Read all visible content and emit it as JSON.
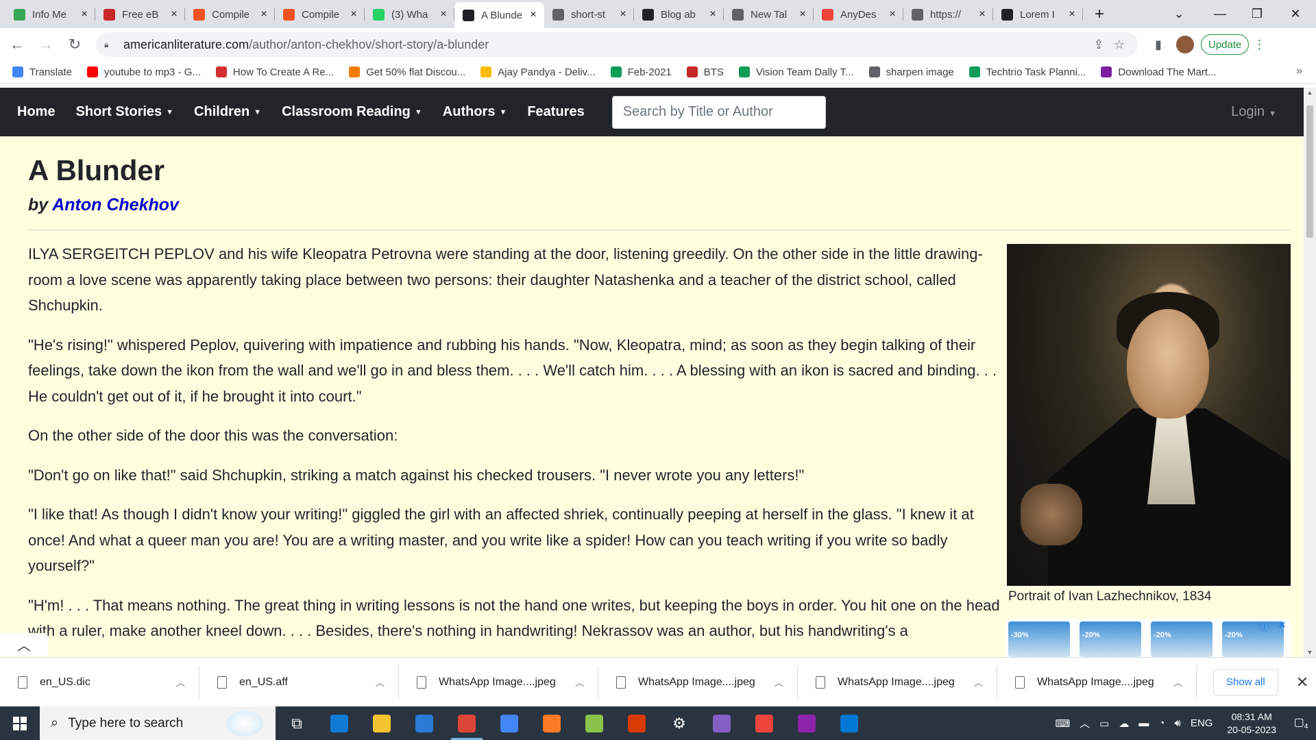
{
  "browser": {
    "tabs": [
      {
        "title": "Info Me",
        "icon": "info-favicon",
        "color": "#34a853"
      },
      {
        "title": "Free eB",
        "icon": "pg-favicon",
        "color": "#c62828"
      },
      {
        "title": "Compile",
        "icon": "microsoft-favicon",
        "color": "#f25022"
      },
      {
        "title": "Compile",
        "icon": "microsoft-favicon",
        "color": "#f25022"
      },
      {
        "title": "(3) Wha",
        "icon": "whatsapp-favicon",
        "color": "#25d366"
      },
      {
        "title": "A Blunde",
        "icon": "al-favicon",
        "color": "#202124"
      },
      {
        "title": "short-st",
        "icon": "globe-favicon",
        "color": "#5f6368"
      },
      {
        "title": "Blog ab",
        "icon": "blog-favicon",
        "color": "#202124"
      },
      {
        "title": "New Tal",
        "icon": "chrome-favicon",
        "color": "#5f6368"
      },
      {
        "title": "AnyDes",
        "icon": "anydesk-favicon",
        "color": "#ef443b"
      },
      {
        "title": "https://",
        "icon": "globe-favicon",
        "color": "#5f6368"
      },
      {
        "title": "Lorem I",
        "icon": "lorem-favicon",
        "color": "#202124"
      }
    ],
    "active_tab_index": 5,
    "url_domain": "americanliterature.com",
    "url_path": "/author/anton-chekhov/short-story/a-blunder",
    "update_label": "Update",
    "bookmarks": [
      {
        "label": "Translate",
        "color": "#4285f4"
      },
      {
        "label": "youtube to mp3 - G...",
        "color": "#ff0000"
      },
      {
        "label": "How To Create A Re...",
        "color": "#d32f2f"
      },
      {
        "label": "Get 50% flat Discou...",
        "color": "#f57c00"
      },
      {
        "label": "Ajay Pandya - Deliv...",
        "color": "#fbbc04"
      },
      {
        "label": "Feb-2021",
        "color": "#0f9d58"
      },
      {
        "label": "BTS",
        "color": "#c62828"
      },
      {
        "label": "Vision Team Dally T...",
        "color": "#0f9d58"
      },
      {
        "label": "sharpen image",
        "color": "#5f6368"
      },
      {
        "label": "Techtrio Task Planni...",
        "color": "#0f9d58"
      },
      {
        "label": "Download The Mart...",
        "color": "#7b1fa2"
      }
    ]
  },
  "site": {
    "nav": [
      {
        "label": "Home",
        "dropdown": false
      },
      {
        "label": "Short Stories",
        "dropdown": true
      },
      {
        "label": "Children",
        "dropdown": true
      },
      {
        "label": "Classroom Reading",
        "dropdown": true
      },
      {
        "label": "Authors",
        "dropdown": true
      },
      {
        "label": "Features",
        "dropdown": false
      }
    ],
    "search_placeholder": "Search by Title or Author",
    "login_label": "Login"
  },
  "story": {
    "title": "A Blunder",
    "by_prefix": "by",
    "author": "Anton Chekhov",
    "paragraphs": [
      "ILYA SERGEITCH PEPLOV and his wife Kleopatra Petrovna were standing at the door, listening greedily. On the other side in the little drawing-room a love scene was apparently taking place between two persons: their daughter Natashenka and a teacher of the district school, called Shchupkin.",
      "\"He's rising!\" whispered Peplov, quivering with impatience and rubbing his hands. \"Now, Kleopatra, mind; as soon as they begin talking of their feelings, take down the ikon from the wall and we'll go in and bless them. . . . We'll catch him. . . . A blessing with an ikon is sacred and binding. . . He couldn't get out of it, if he brought it into court.\"",
      "On the other side of the door this was the conversation:",
      "\"Don't go on like that!\" said Shchupkin, striking a match against his checked trousers. \"I never wrote you any letters!\"",
      "\"I like that! As though I didn't know your writing!\" giggled the girl with an affected shriek, continually peeping at herself in the glass. \"I knew it at once! And what a queer man you are! You are a writing master, and you write like a spider! How can you teach writing if you write so badly yourself?\"",
      "\"H'm! . . . That means nothing. The great thing in writing lessons is not the hand one writes, but keeping the boys in order. You hit one on the head with a ruler, make another kneel down. . . . Besides, there's nothing in handwriting! Nekrassov was an author, but his handwriting's a"
    ],
    "image_caption": "Portrait of Ivan Lazhechnikov, 1834",
    "ad_badges": [
      "-30%",
      "-20%",
      "-20%",
      "-20%"
    ]
  },
  "downloads": {
    "items": [
      "en_US.dic",
      "en_US.aff",
      "WhatsApp Image....jpeg",
      "WhatsApp Image....jpeg",
      "WhatsApp Image....jpeg",
      "WhatsApp Image....jpeg"
    ],
    "show_all": "Show all"
  },
  "taskbar": {
    "search_placeholder": "Type here to search",
    "apps": [
      "task-view-icon",
      "edge-icon",
      "file-explorer-icon",
      "mail-icon",
      "chrome-icon",
      "microsoft-store-icon",
      "xampp-icon",
      "notepad-plus-icon",
      "office-icon",
      "settings-icon",
      "visual-studio-icon",
      "anydesk-icon",
      "winrar-icon",
      "photos-icon"
    ],
    "language": "ENG",
    "time": "08:31 AM",
    "date": "20-05-2023",
    "notification_count": "4"
  }
}
